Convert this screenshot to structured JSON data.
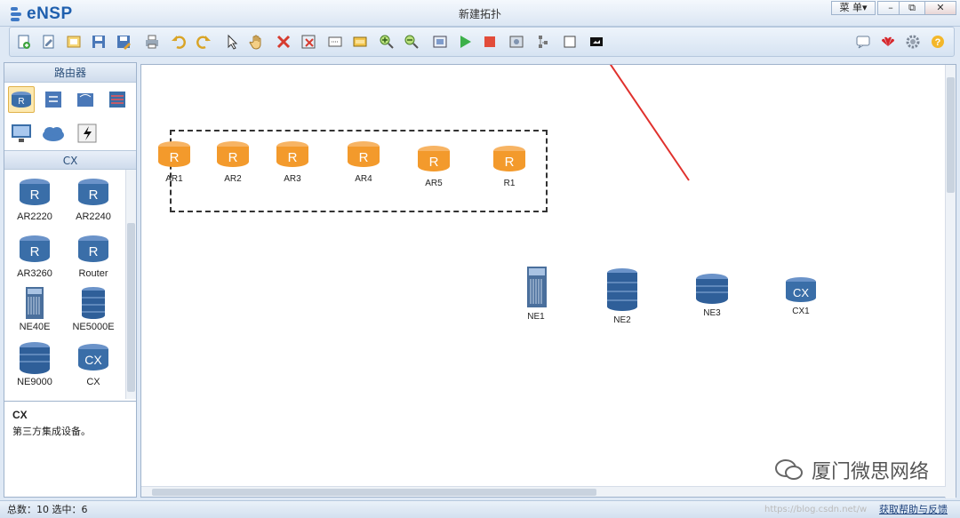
{
  "app": {
    "name": "eNSP",
    "window_title": "新建拓扑"
  },
  "window_controls": {
    "menu": "菜 单▾",
    "minimize": "–",
    "restore": "⧉",
    "close": "✕"
  },
  "toolbar": {
    "left_icons": [
      "new-topology-icon",
      "new-exam-icon",
      "open-icon",
      "save-icon",
      "save-as-icon",
      "print-icon",
      "undo-icon",
      "redo-icon",
      "select-icon",
      "pan-hand-icon",
      "delete-icon",
      "delete-link-icon",
      "text-icon",
      "palette-icon",
      "zoom-in-icon",
      "zoom-out-icon",
      "topology-fit-icon",
      "start-device-icon",
      "stop-device-icon",
      "capture-icon",
      "topology-icon",
      "full-screen-icon",
      "screenshot-icon"
    ],
    "right_icons": [
      "chat-icon",
      "huawei-logo-icon",
      "settings-icon",
      "help-icon"
    ]
  },
  "left_panel": {
    "routers_header": "路由器",
    "cx_header": "CX",
    "devices": [
      {
        "label": "AR2220",
        "type": "router"
      },
      {
        "label": "AR2240",
        "type": "router"
      },
      {
        "label": "AR3260",
        "type": "router"
      },
      {
        "label": "Router",
        "type": "router"
      },
      {
        "label": "NE40E",
        "type": "ne40e"
      },
      {
        "label": "NE5000E",
        "type": "ne5000e"
      },
      {
        "label": "NE9000",
        "type": "ne9000"
      },
      {
        "label": "CX",
        "type": "cx"
      }
    ],
    "description": {
      "title": "CX",
      "text": "第三方集成设备。"
    }
  },
  "canvas": {
    "selected_nodes": [
      {
        "label": "AR1"
      },
      {
        "label": "AR2"
      },
      {
        "label": "AR3"
      },
      {
        "label": "AR4"
      },
      {
        "label": "AR5"
      },
      {
        "label": "R1"
      }
    ],
    "other_nodes": [
      {
        "label": "NE1",
        "type": "ne40e"
      },
      {
        "label": "NE2",
        "type": "ne5000e"
      },
      {
        "label": "NE3",
        "type": "ne9000"
      },
      {
        "label": "CX1",
        "type": "cx"
      }
    ],
    "watermark": "厦门微思网络"
  },
  "status": {
    "left": "总数：10  选中：6",
    "faint": "https://blog.csdn.net/w",
    "help_link": "获取帮助与反馈"
  },
  "colors": {
    "router_orange": "#f39a2c",
    "device_blue": "#3a6ea8",
    "arrow_red": "#e0312d"
  }
}
